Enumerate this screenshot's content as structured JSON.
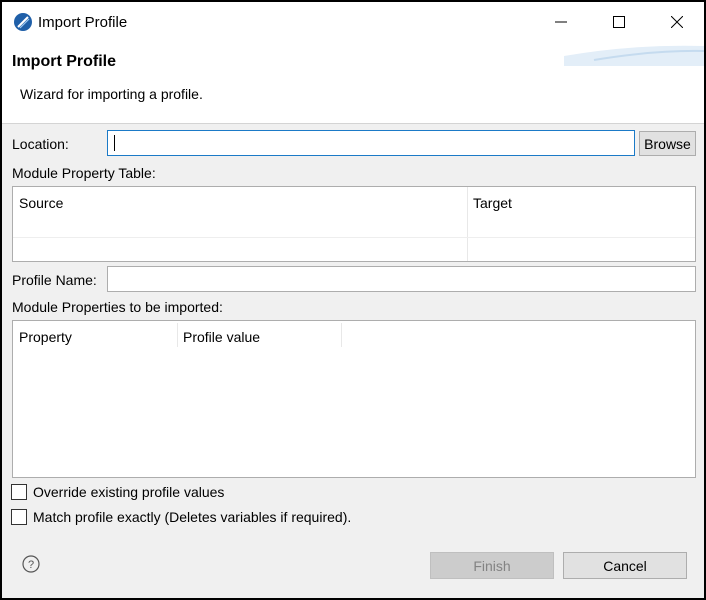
{
  "window": {
    "title": "Import Profile",
    "controls": {
      "minimize": "─",
      "maximize": "☐",
      "close": "✕"
    }
  },
  "banner": {
    "title": "Import Profile",
    "description": "Wizard for importing a profile."
  },
  "form": {
    "location_label": "Location:",
    "location_value": "",
    "browse_label": "Browse",
    "module_table_label": "Module Property Table:",
    "module_table_columns": [
      "Source",
      "Target"
    ],
    "profile_name_label": "Profile Name:",
    "profile_name_value": "",
    "properties_label": "Module Properties to be imported:",
    "properties_columns": [
      "Property",
      "Profile value"
    ],
    "override_label": "Override existing profile values",
    "override_checked": false,
    "match_label": "Match profile exactly (Deletes variables if required).",
    "match_checked": false
  },
  "footer": {
    "help_icon": "question-circle",
    "finish_label": "Finish",
    "finish_enabled": false,
    "cancel_label": "Cancel"
  }
}
